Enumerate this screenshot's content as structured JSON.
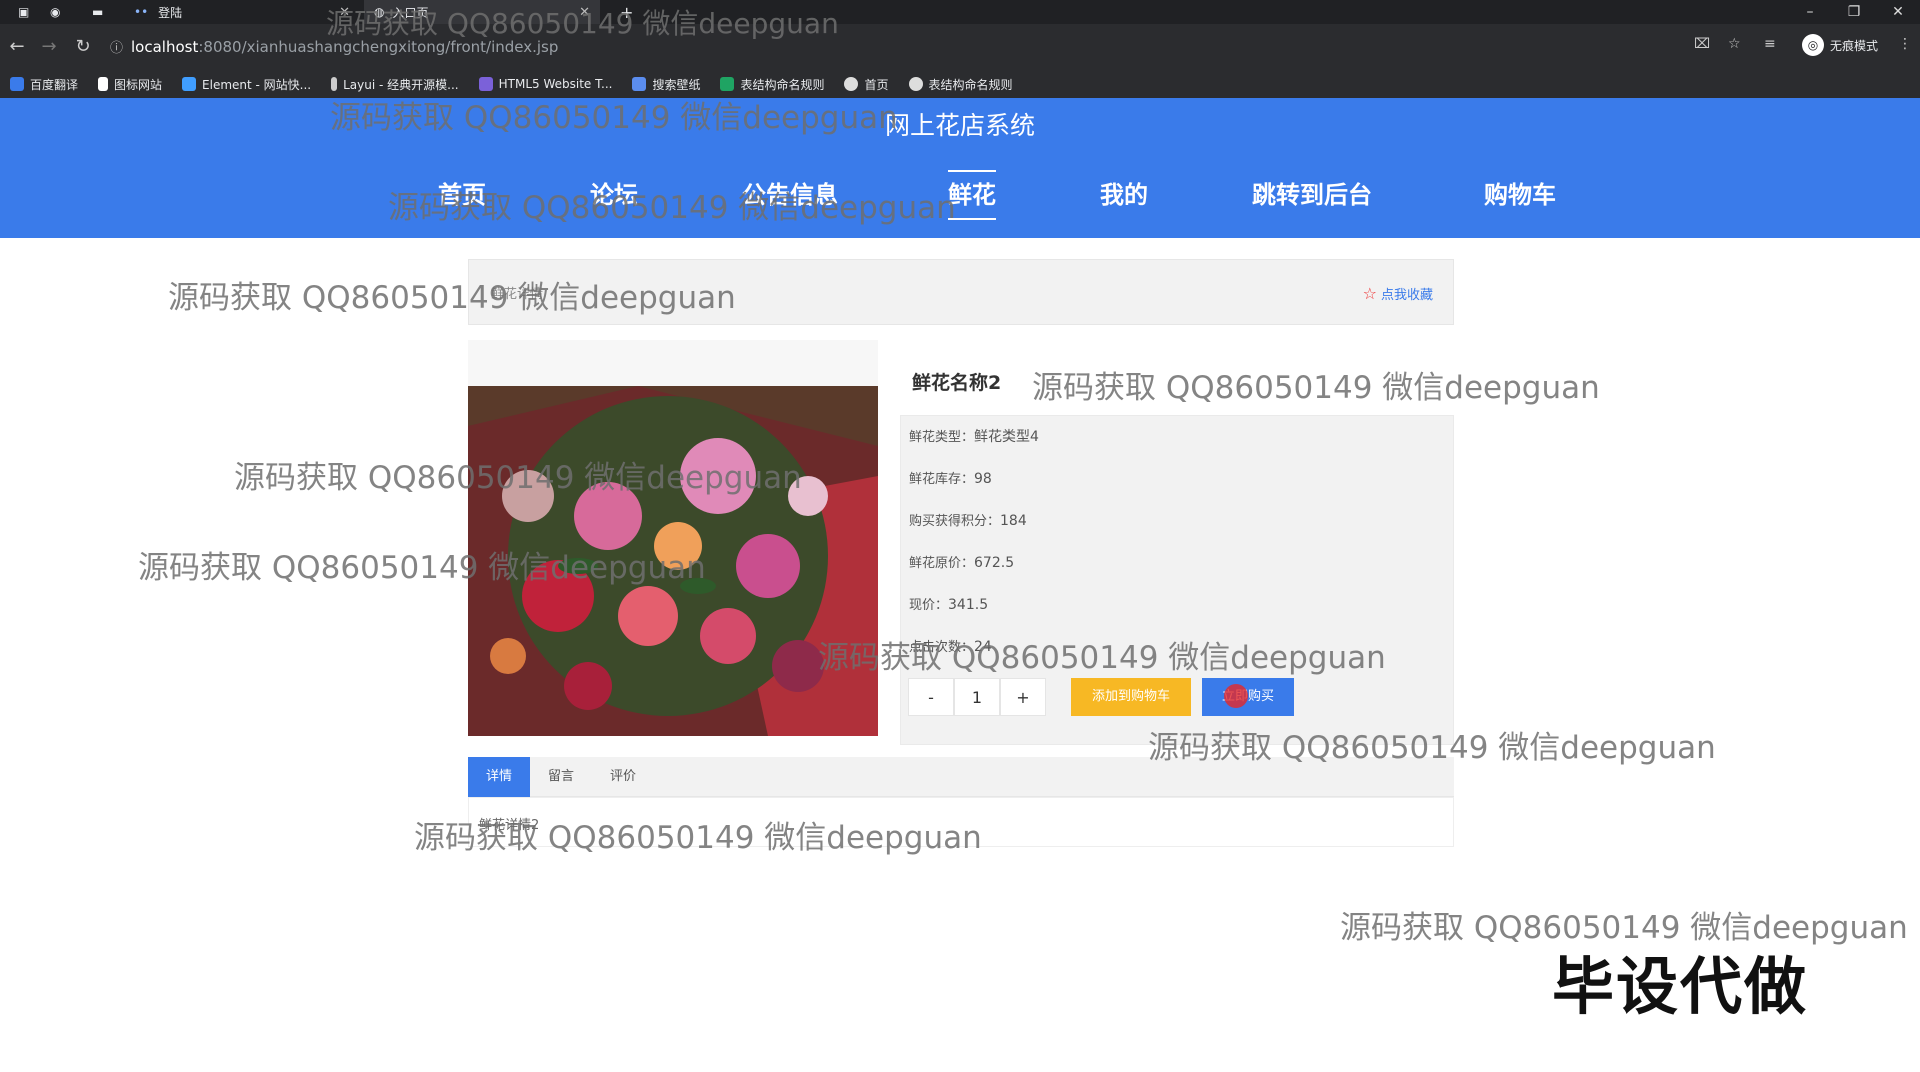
{
  "browser": {
    "tabs": [
      {
        "label": "登陆"
      },
      {
        "label": "入口页"
      }
    ],
    "new_tab": "+",
    "url_host": "localhost",
    "url_path": ":8080/xianhuashangchengxitong/front/index.jsp",
    "incognito_label": "无痕模式",
    "bookmarks": [
      {
        "label": "百度翻译",
        "color": "#3a7bea"
      },
      {
        "label": "图标网站",
        "color": "#ffffff"
      },
      {
        "label": "Element - 网站快...",
        "color": "#409eff"
      },
      {
        "label": "Layui - 经典开源模...",
        "color": "#cccccc"
      },
      {
        "label": "HTML5 Website T...",
        "color": "#7b61d9"
      },
      {
        "label": "搜索壁纸",
        "color": "#5b8def"
      },
      {
        "label": "表结构命名规则",
        "color": "#1fa463"
      },
      {
        "label": "首页",
        "color": "#dddddd"
      },
      {
        "label": "表结构命名规则",
        "color": "#dddddd"
      }
    ]
  },
  "site": {
    "title": "网上花店系统",
    "nav": [
      {
        "label": "首页"
      },
      {
        "label": "论坛"
      },
      {
        "label": "公告信息"
      },
      {
        "label": "鲜花",
        "active": true
      },
      {
        "label": "我的"
      },
      {
        "label": "跳转到后台"
      },
      {
        "label": "购物车"
      }
    ],
    "accent_color": "#3a7bea"
  },
  "product": {
    "breadcrumb": "鲜花详情",
    "favorite_label": "点我收藏",
    "name": "鲜花名称2",
    "rows": [
      {
        "label": "鲜花类型：",
        "value": "鲜花类型4"
      },
      {
        "label": "鲜花库存：",
        "value": "98"
      },
      {
        "label": "购买获得积分：",
        "value": "184"
      },
      {
        "label": "鲜花原价：",
        "value": "672.5"
      },
      {
        "label": "现价：",
        "value": "341.5"
      },
      {
        "label": "点击次数：",
        "value": "24"
      }
    ],
    "qty_minus": "-",
    "qty_value": "1",
    "qty_plus": "+",
    "add_to_cart": "添加到购物车",
    "buy_now": "立即购买",
    "tabs": [
      {
        "label": "详情",
        "active": true
      },
      {
        "label": "留言"
      },
      {
        "label": "评价"
      }
    ],
    "detail_text": "鲜花详情2"
  },
  "watermark": {
    "text": "源码获取 QQ86050149 微信deepguan",
    "stamp": "毕设代做"
  }
}
